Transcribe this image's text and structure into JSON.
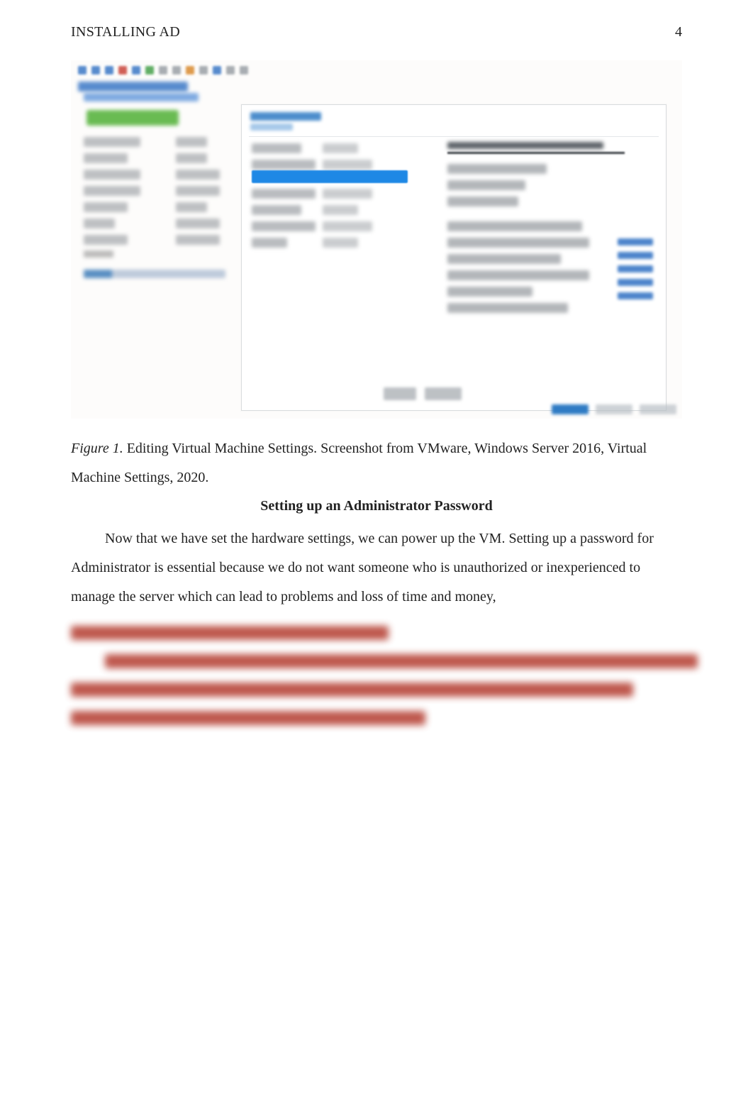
{
  "header": {
    "running_head": "INSTALLING AD",
    "page_number": "4"
  },
  "figure": {
    "label": "Figure 1.",
    "caption_rest": "  Editing Virtual Machine Settings.  Screenshot from VMware, Windows Server 2016, Virtual Machine Settings, 2020."
  },
  "section": {
    "heading": "Setting up an Administrator Password",
    "paragraph": "Now that we have set the hardware settings, we can power up the VM.  Setting up a password for Administrator is essential because we do not want someone who is unauthorized or inexperienced to manage the server which can lead to problems and loss of time and money,"
  },
  "screenshot": {
    "toolbar_colors": [
      "c-blue",
      "c-blue",
      "c-blue",
      "c-red",
      "c-blue",
      "c-green",
      "c-gray",
      "c-gray",
      "c-orange",
      "c-gray",
      "c-blue",
      "c-gray",
      "c-gray"
    ]
  }
}
